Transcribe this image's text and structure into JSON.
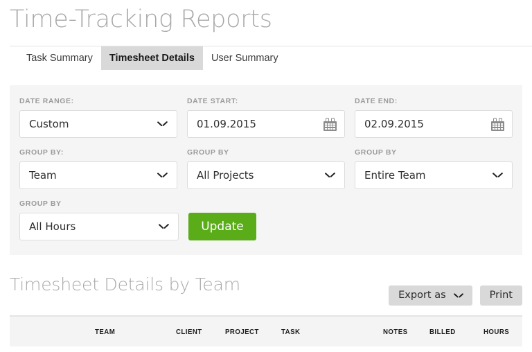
{
  "page": {
    "title": "Time-Tracking Reports"
  },
  "tabs": [
    {
      "label": "Task Summary",
      "active": false
    },
    {
      "label": "Timesheet Details",
      "active": true
    },
    {
      "label": "User Summary",
      "active": false
    }
  ],
  "filters": {
    "date_range": {
      "label": "DATE RANGE:",
      "value": "Custom",
      "control": "select"
    },
    "date_start": {
      "label": "DATE START:",
      "value": "01.09.2015",
      "control": "date",
      "icon": "calendar-icon"
    },
    "date_end": {
      "label": "DATE END:",
      "value": "02.09.2015",
      "control": "date",
      "icon": "calendar-icon"
    },
    "group_by_team": {
      "label": "GROUP BY:",
      "value": "Team",
      "control": "select"
    },
    "group_by_project": {
      "label": "GROUP BY",
      "value": "All Projects",
      "control": "select"
    },
    "group_by_member": {
      "label": "GROUP BY",
      "value": "Entire Team",
      "control": "select"
    },
    "group_by_hours": {
      "label": "GROUP BY",
      "value": "All Hours",
      "control": "select"
    },
    "update_button": {
      "label": "Update",
      "color": "#5aac18"
    }
  },
  "report": {
    "section_title": "Timesheet Details by Team",
    "export_button": {
      "label": "Export as",
      "icon": "chevron-down-icon"
    },
    "print_button": {
      "label": "Print"
    },
    "table": {
      "columns": [
        "TEAM",
        "CLIENT",
        "PROJECT",
        "TASK",
        "NOTES",
        "BILLED",
        "HOURS"
      ],
      "rows": []
    }
  },
  "colors": {
    "accent_green": "#5aac18",
    "panel_bg": "#f5f5f5",
    "table_header_bg": "#f4f4f4",
    "active_tab_bg": "#d9d9d9",
    "title_gray": "#a8a8a8"
  }
}
